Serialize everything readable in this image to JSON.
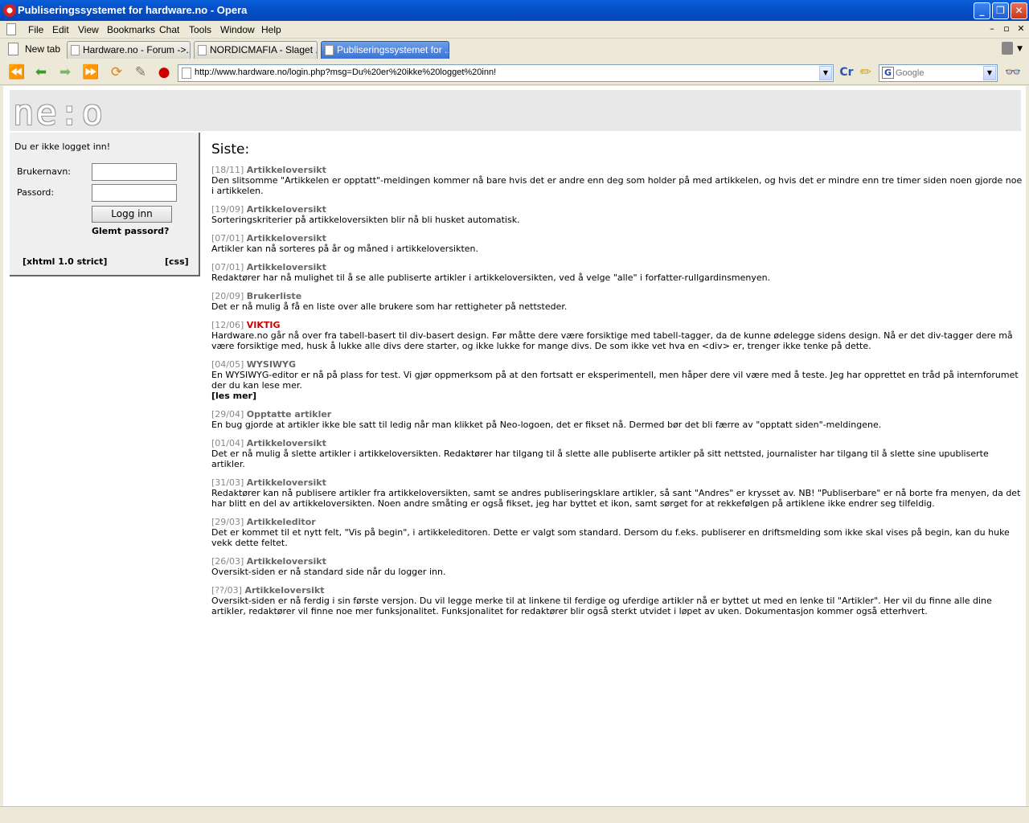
{
  "window": {
    "title": "Publiseringssystemet for hardware.no - Opera",
    "minimize": "_",
    "restore": "❐",
    "close": "✕"
  },
  "menu": {
    "items": [
      "File",
      "Edit",
      "View",
      "Bookmarks",
      "Chat",
      "Tools",
      "Window",
      "Help"
    ],
    "mdi": [
      "–",
      "▫",
      "✕"
    ]
  },
  "tabs": {
    "new_tab": "New tab",
    "items": [
      {
        "label": "Hardware.no - Forum ->..."
      },
      {
        "label": "NORDICMAFIA - Slaget ..."
      },
      {
        "label": "Publiseringssystemet for ..."
      }
    ]
  },
  "nav": {
    "url": "http://www.hardware.no/login.php?msg=Du%20er%20ikke%20logget%20inn!",
    "search_placeholder": "Google",
    "search_engine_glyph": "G"
  },
  "page": {
    "logo": "ne:o",
    "login": {
      "status": "Du er ikke logget inn!",
      "username_label": "Brukernavn:",
      "password_label": "Passord:",
      "username_value": "",
      "password_value": "",
      "button": "Logg inn",
      "forgot": "Glemt passord?",
      "xhtml": "[xhtml 1.0 strict]",
      "css": "[css]"
    },
    "heading": "Siste:",
    "news": [
      {
        "date": "[18/11]",
        "title": "Artikkeloversikt",
        "text": "Den slitsomme \"Artikkelen er opptatt\"-meldingen kommer nå bare hvis det er andre enn deg som holder på med artikkelen, og hvis det er mindre enn tre timer siden noen gjorde noe i artikkelen."
      },
      {
        "date": "[19/09]",
        "title": "Artikkeloversikt",
        "text": "Sorteringskriterier på artikkeloversikten blir nå bli husket automatisk."
      },
      {
        "date": "[07/01]",
        "title": "Artikkeloversikt",
        "text": "Artikler kan nå sorteres på år og måned i artikkeloversikten."
      },
      {
        "date": "[07/01]",
        "title": "Artikkeloversikt",
        "text": "Redaktører har nå mulighet til å se alle publiserte artikler i artikkeloversikten, ved å velge \"alle\" i forfatter-rullgardinsmenyen."
      },
      {
        "date": "[20/09]",
        "title": "Brukerliste",
        "text": "Det er nå mulig å få en liste over alle brukere som har rettigheter på nettsteder."
      },
      {
        "date": "[12/06]",
        "title": "VIKTIG",
        "text": "Hardware.no går nå over fra tabell-basert til div-basert design. Før måtte dere være forsiktige med tabell-tagger, da de kunne ødelegge sidens design. Nå er det div-tagger dere må være forsiktige med, husk å lukke alle divs dere starter, og ikke lukke for mange divs. De som ikke vet hva en <div> er, trenger ikke tenke på dette."
      },
      {
        "date": "[04/05]",
        "title": "WYSIWYG",
        "text": "En WYSIWYG-editor er nå på plass for test. Vi gjør oppmerksom på at den fortsatt er eksperimentell, men håper dere vil være med å teste. Jeg har opprettet en tråd på internforumet der du kan lese mer.",
        "more": "[les mer]"
      },
      {
        "date": "[29/04]",
        "title": "Opptatte artikler",
        "text": "En bug gjorde at artikler ikke ble satt til ledig når man klikket på Neo-logoen, det er fikset nå. Dermed bør det bli færre av \"opptatt siden\"-meldingene."
      },
      {
        "date": "[01/04]",
        "title": "Artikkeloversikt",
        "text": "Det er nå mulig å slette artikler i artikkeloversikten. Redaktører har tilgang til å slette alle publiserte artikler på sitt nettsted, journalister har tilgang til å slette sine upubliserte artikler."
      },
      {
        "date": "[31/03]",
        "title": "Artikkeloversikt",
        "text": "Redaktører kan nå publisere artikler fra artikkeloversikten, samt se andres publiseringsklare artikler, så sant \"Andres\" er krysset av. NB! \"Publiserbare\" er nå borte fra menyen, da det har blitt en del av artikkeloversikten. Noen andre småting er også fikset, jeg har byttet et ikon, samt sørget for at rekkefølgen på artiklene ikke endrer seg tilfeldig."
      },
      {
        "date": "[29/03]",
        "title": "Artikkeleditor",
        "text": "Det er kommet til et nytt felt, \"Vis på begin\", i artikkeleditoren. Dette er valgt som standard. Dersom du f.eks. publiserer en driftsmelding som ikke skal vises på begin, kan du huke vekk dette feltet."
      },
      {
        "date": "[26/03]",
        "title": "Artikkeloversikt",
        "text": "Oversikt-siden er nå standard side når du logger inn."
      },
      {
        "date": "[??/03]",
        "title": "Artikkeloversikt",
        "text": "Oversikt-siden er nå ferdig i sin første versjon. Du vil legge merke til at linkene til ferdige og uferdige artikler nå er byttet ut med en lenke til \"Artikler\". Her vil du finne alle dine artikler, redaktører vil finne noe mer funksjonalitet. Funksjonalitet for redaktører blir også sterkt utvidet i løpet av uken. Dokumentasjon kommer også etterhvert."
      }
    ]
  },
  "colors": {
    "titlebar": "#0550c8",
    "urgent": "#cc0000",
    "news_title": "#666666",
    "date": "#888888"
  }
}
